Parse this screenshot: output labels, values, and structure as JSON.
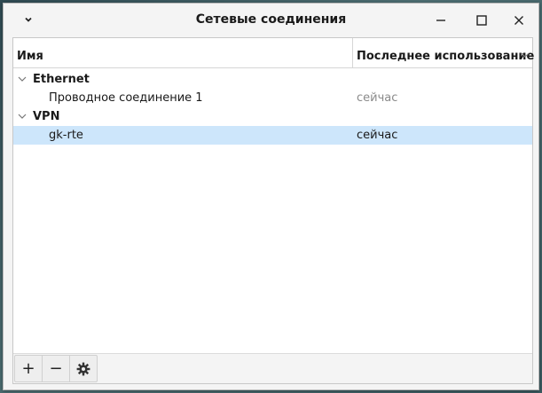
{
  "window": {
    "title": "Сетевые соединения"
  },
  "table": {
    "columns": {
      "name": "Имя",
      "last_used": "Последнее использование"
    },
    "groups": [
      {
        "label": "Ethernet",
        "items": [
          {
            "name": "Проводное соединение 1",
            "last_used": "сейчас",
            "selected": false
          }
        ]
      },
      {
        "label": "VPN",
        "items": [
          {
            "name": "gk-rte",
            "last_used": "сейчас",
            "selected": true
          }
        ]
      }
    ]
  },
  "toolbar": {
    "add_label": "+",
    "remove_label": "−"
  },
  "icons": {
    "window_menu": "chevron-down-icon",
    "minimize": "minimize-icon",
    "maximize": "maximize-icon",
    "close": "close-icon",
    "settings": "gear-icon"
  },
  "colors": {
    "selection": "#cde6fb",
    "muted_text": "#8a8a8a"
  }
}
